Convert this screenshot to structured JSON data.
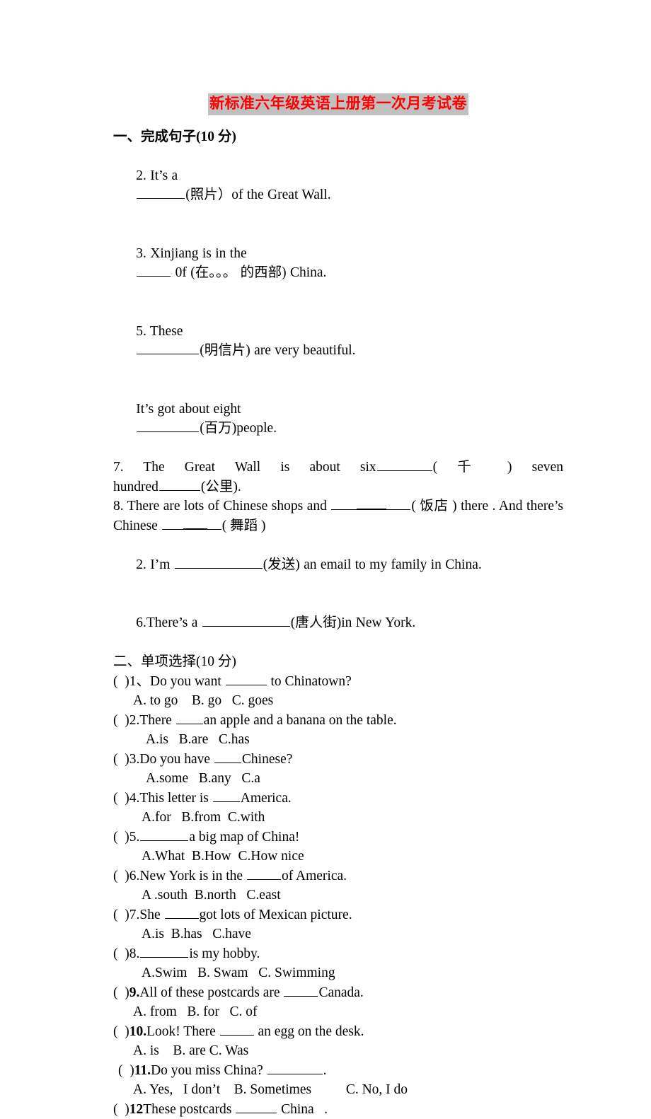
{
  "document": {
    "title": "新标准六年级英语上册第一次月考试卷",
    "title_color": "#ff0000",
    "title_highlight_color": "#c0c0c0"
  },
  "section1": {
    "heading": "一、完成句子(10 分)",
    "items": [
      {
        "prefix": "2. It’s a",
        "mid": "(照片）of the Great Wall."
      },
      {
        "prefix": "3. Xinjiang is in the",
        "mid": " 0f (在。。。 的西部) China."
      },
      {
        "prefix": "5. These",
        "mid": "(明信片) are very beautiful."
      },
      {
        "prefix": "It’s got about eight",
        "mid": "(百万)people."
      }
    ],
    "item7": {
      "line1_words": [
        "7. The",
        "Great",
        "Wall",
        "is",
        "about",
        "six"
      ],
      "line1_tail": "(  千  )",
      "line1_last": "seven",
      "line2_pre": "hundred",
      "line2_post": "(公里)."
    },
    "item8": {
      "pre": "8. There are lots of Chinese shops and ",
      "mid": "(  饭店  ) there . And",
      "line2_pre": "there’s Chinese ",
      "line2_post": "(  舞蹈  )"
    },
    "item_send": {
      "prefix": "2. I’m ",
      "mid": "(发送) an email to my family in China."
    },
    "item_chinatown": {
      "prefix": "6.There’s a ",
      "mid": "(唐人街)in New York."
    }
  },
  "section2": {
    "heading": "二、单项选择(10 分)",
    "questions": [
      {
        "marker": "(  )",
        "number": "1、",
        "bold_number": false,
        "pre": "Do you want ",
        "post": " to Chinatown?",
        "options": "A. to go    B. go   C. goes",
        "opt_indent": "op-shal"
      },
      {
        "marker": "(  )",
        "number": "2.",
        "bold_number": false,
        "pre": "There ",
        "post": "an apple and a banana on the table.",
        "options": "A.is   B.are   C.has",
        "opt_indent": "op-deep"
      },
      {
        "marker": "(  )",
        "number": "3.",
        "bold_number": false,
        "pre": "Do you have ",
        "post": "Chinese?",
        "options": "A.some   B.any   C.a",
        "opt_indent": "op-deep"
      },
      {
        "marker": "(  )",
        "number": "4.",
        "bold_number": false,
        "pre": "This letter is ",
        "post": "America.",
        "options": "A.for   B.from  C.with",
        "opt_indent": "op-mid"
      },
      {
        "marker": "(  )",
        "number": "5.",
        "bold_number": false,
        "pre": "",
        "post": "a big map of China!",
        "options": "A.What  B.How  C.How nice",
        "opt_indent": "op-mid"
      },
      {
        "marker": "(  )",
        "number": "6.",
        "bold_number": false,
        "pre": "New York is in the ",
        "post": "of America.",
        "options": "A .south  B.north   C.east",
        "opt_indent": "op-mid"
      },
      {
        "marker": "(  )",
        "number": "7.",
        "bold_number": false,
        "pre": "She ",
        "post": "got lots of Mexican picture.",
        "options": "A.is  B.has   C.have",
        "opt_indent": "op-mid"
      },
      {
        "marker": "(  )",
        "number": "8.",
        "bold_number": false,
        "pre": "",
        "post": "is my hobby.",
        "options": "A.Swim   B. Swam   C. Swimming",
        "opt_indent": "op-mid"
      },
      {
        "marker": "(  )",
        "number": "9.",
        "bold_number": true,
        "pre": "All of these postcards are ",
        "post": "Canada.",
        "options": "A. from   B. for   C. of",
        "opt_indent": "op-shal"
      },
      {
        "marker": "(  )",
        "number": "10.",
        "bold_number": true,
        "pre": "Look! There ",
        "post": " an egg on the desk.",
        "options": "A. is    B. are C. Was",
        "opt_indent": "op-shal"
      },
      {
        "marker": "(  )",
        "number": "11.",
        "bold_number": true,
        "pre": "Do you miss China? ",
        "post": ".",
        "options": "A. Yes,   I don’t    B. Sometimes          C. No, I do",
        "opt_indent": "op-shal"
      },
      {
        "marker": "(  )",
        "number": "12",
        "bold_number": true,
        "pre": "These postcards ",
        "post": " China   .",
        "options": "",
        "opt_indent": "op-shal"
      }
    ]
  }
}
